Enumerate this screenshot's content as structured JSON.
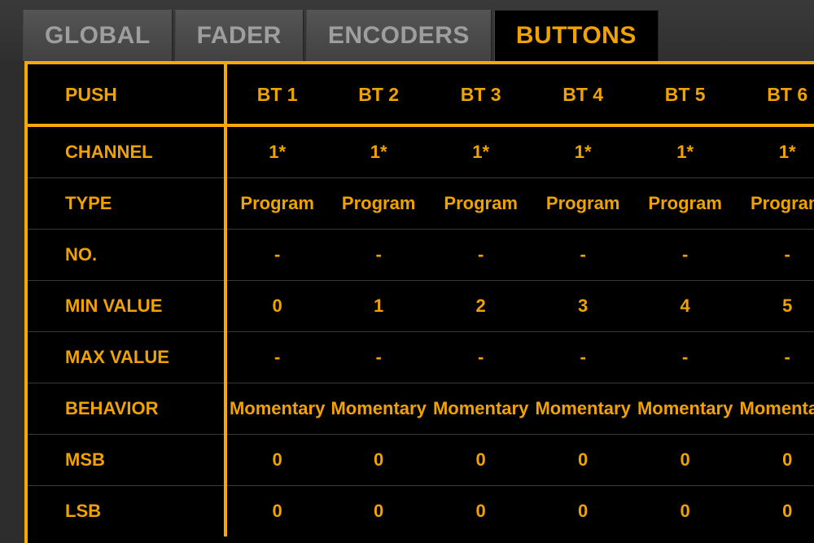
{
  "tabs": {
    "items": [
      {
        "label": "GLOBAL",
        "active": false
      },
      {
        "label": "FADER",
        "active": false
      },
      {
        "label": "ENCODERS",
        "active": false
      },
      {
        "label": "BUTTONS",
        "active": true
      }
    ]
  },
  "table": {
    "corner_label": "PUSH",
    "columns": [
      "BT 1",
      "BT 2",
      "BT 3",
      "BT 4",
      "BT 5",
      "BT 6"
    ],
    "rows": [
      {
        "label": "CHANNEL",
        "cells": [
          "1*",
          "1*",
          "1*",
          "1*",
          "1*",
          "1*"
        ]
      },
      {
        "label": "TYPE",
        "cells": [
          "Program",
          "Program",
          "Program",
          "Program",
          "Program",
          "Program"
        ]
      },
      {
        "label": "NO.",
        "cells": [
          "-",
          "-",
          "-",
          "-",
          "-",
          "-"
        ]
      },
      {
        "label": "MIN VALUE",
        "cells": [
          "0",
          "1",
          "2",
          "3",
          "4",
          "5"
        ]
      },
      {
        "label": "MAX VALUE",
        "cells": [
          "-",
          "-",
          "-",
          "-",
          "-",
          "-"
        ]
      },
      {
        "label": "BEHAVIOR",
        "cells": [
          "Momentary",
          "Momentary",
          "Momentary",
          "Momentary",
          "Momentary",
          "Momentary"
        ]
      },
      {
        "label": "MSB",
        "cells": [
          "0",
          "0",
          "0",
          "0",
          "0",
          "0"
        ]
      },
      {
        "label": "LSB",
        "cells": [
          "0",
          "0",
          "0",
          "0",
          "0",
          "0"
        ]
      }
    ]
  }
}
